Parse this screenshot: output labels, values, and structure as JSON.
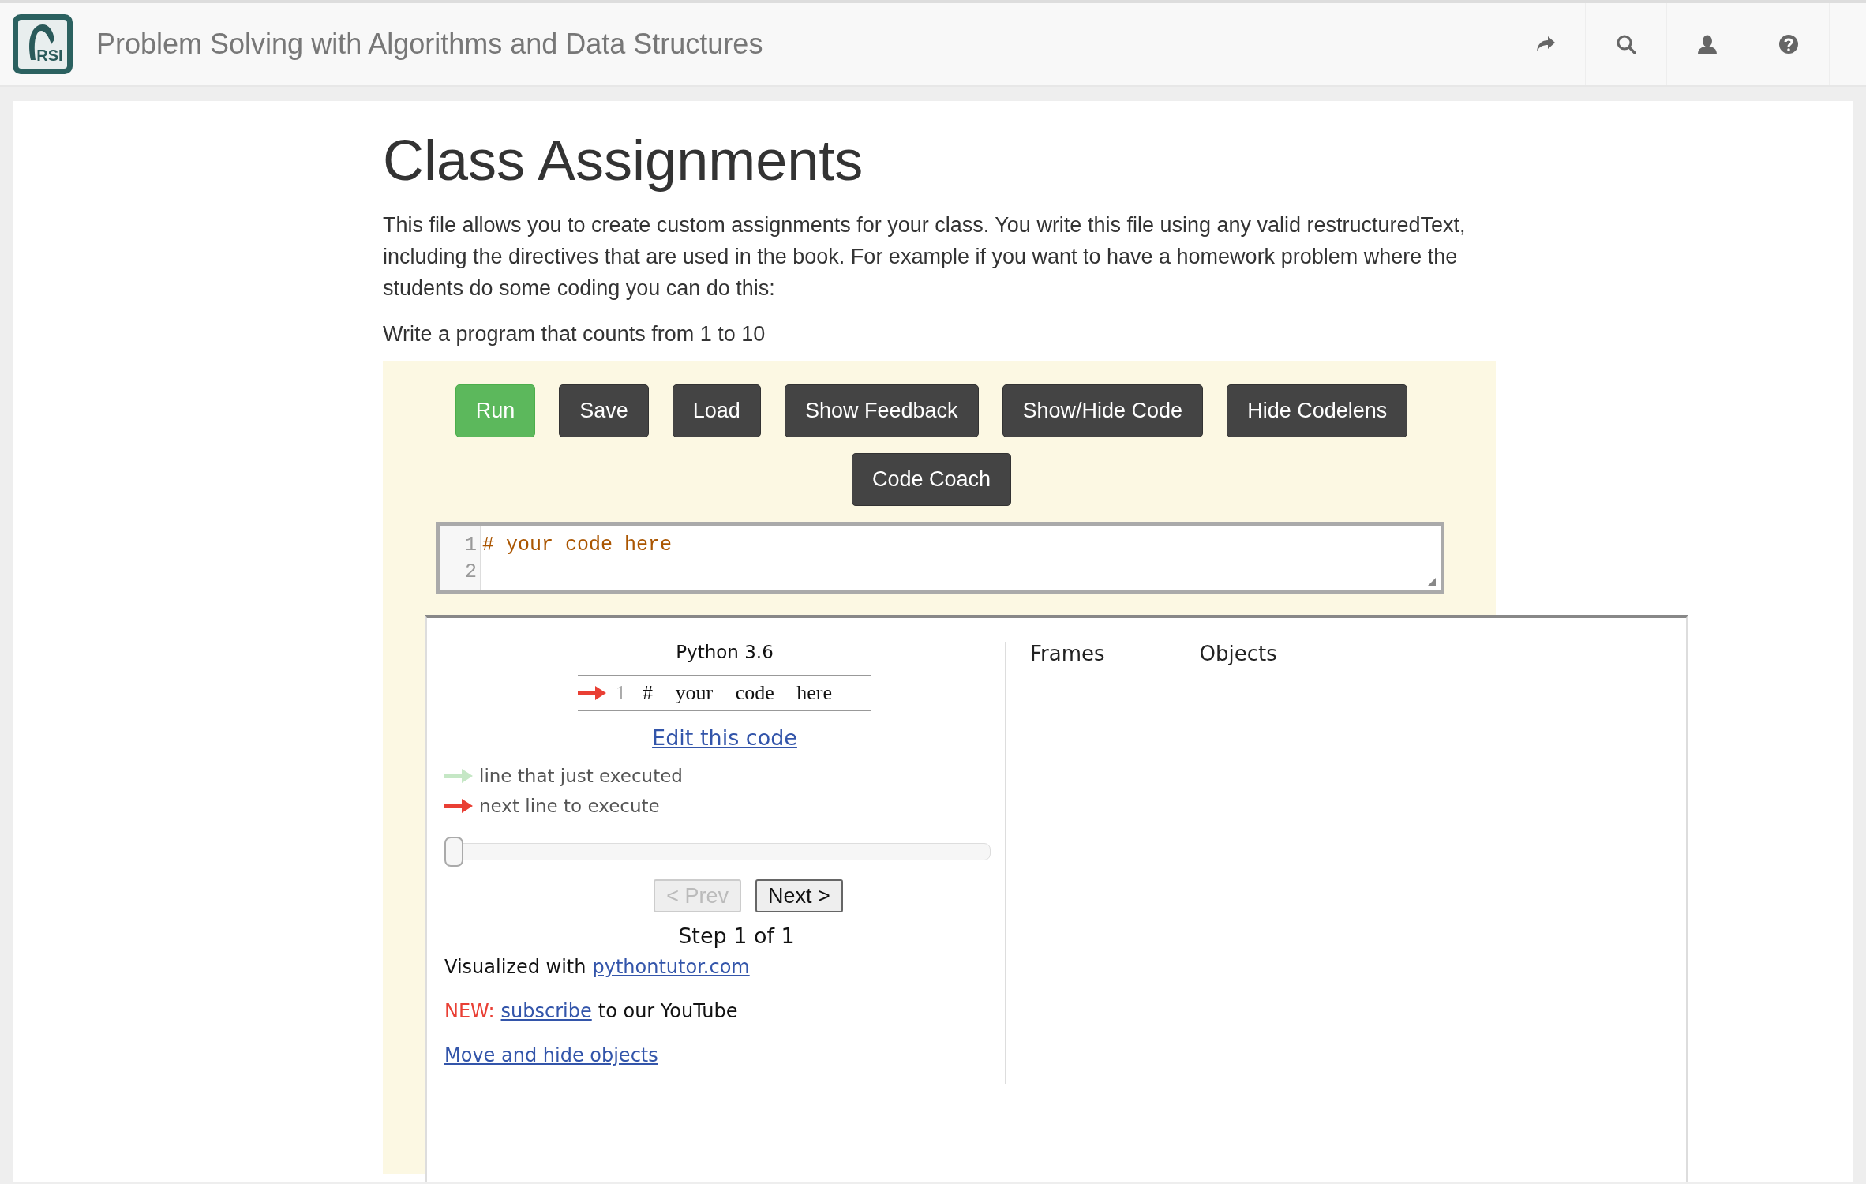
{
  "navbar": {
    "logo_text": "RSI",
    "title": "Problem Solving with Algorithms and Data Structures"
  },
  "page": {
    "heading": "Class Assignments",
    "intro": "This file allows you to create custom assignments for your class. You write this file using any valid restructuredText, including the directives that are used in the book. For example if you want to have a homework problem where the students do some coding you can do this:",
    "prompt": "Write a program that counts from 1 to 10"
  },
  "activecode": {
    "button_rows": [
      [
        {
          "label": "Run",
          "kind": "run"
        },
        {
          "label": "Save",
          "kind": "default"
        },
        {
          "label": "Load",
          "kind": "default"
        },
        {
          "label": "Show Feedback",
          "kind": "default"
        },
        {
          "label": "Show/Hide Code",
          "kind": "default"
        },
        {
          "label": "Hide Codelens",
          "kind": "default"
        }
      ],
      [
        {
          "label": "Code Coach",
          "kind": "default"
        }
      ]
    ],
    "editor_lines": [
      {
        "number": "1",
        "text": "# your code here"
      },
      {
        "number": "2"
      }
    ]
  },
  "visualizer": {
    "language": "Python 3.6",
    "code_lines": [
      {
        "number": "1",
        "text": "# your code here",
        "current": true
      }
    ],
    "edit_link": "Edit this code",
    "legend": [
      {
        "kind": "executed",
        "text": "line that just executed"
      },
      {
        "kind": "next",
        "text": "next line to execute"
      }
    ],
    "slider": {
      "level": 0
    },
    "prev": {
      "label": "< Prev",
      "disabled": true
    },
    "next": {
      "label": "Next >",
      "disabled": false
    },
    "step": "Step 1 of 1",
    "credit": {
      "text": "Visualized with",
      "link": "pythontutor.com"
    },
    "news": {
      "tag": "NEW:",
      "link": "subscribe",
      "text": "to our YouTube"
    },
    "move_link": "Move and hide objects",
    "headers": [
      "Frames",
      "Objects"
    ]
  }
}
